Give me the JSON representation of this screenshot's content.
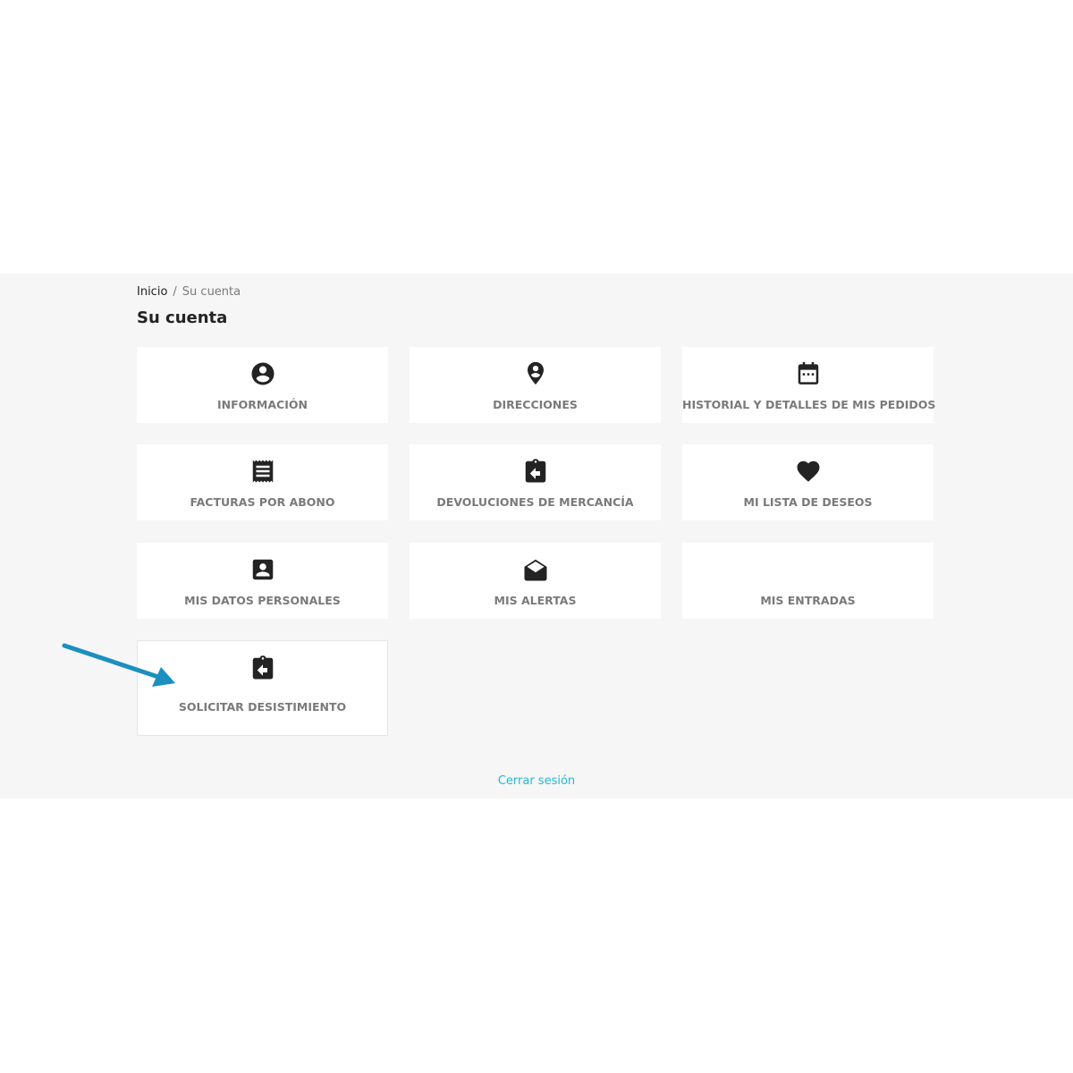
{
  "breadcrumb": {
    "home": "Inicio",
    "separator": "/",
    "current": "Su cuenta"
  },
  "page_title": "Su cuenta",
  "tiles": [
    {
      "label": "INFORMACIÓN",
      "icon": "account-circle-icon"
    },
    {
      "label": "DIRECCIONES",
      "icon": "location-pin-icon"
    },
    {
      "label": "HISTORIAL Y DETALLES DE MIS PEDIDOS",
      "icon": "calendar-icon"
    },
    {
      "label": "FACTURAS POR ABONO",
      "icon": "receipt-icon"
    },
    {
      "label": "DEVOLUCIONES DE MERCANCÍA",
      "icon": "clipboard-return-icon"
    },
    {
      "label": "MI LISTA DE DESEOS",
      "icon": "heart-icon"
    },
    {
      "label": "MIS DATOS PERSONALES",
      "icon": "contact-card-icon"
    },
    {
      "label": "MIS ALERTAS",
      "icon": "envelope-open-icon"
    },
    {
      "label": "MIS ENTRADAS",
      "icon": ""
    },
    {
      "label": "SOLICITAR DESISTIMIENTO",
      "icon": "clipboard-return-icon"
    }
  ],
  "logout_label": "Cerrar sesión",
  "colors": {
    "background_band": "#f6f6f6",
    "tile": "#ffffff",
    "label": "#7a7a7a",
    "link": "#24b9d7",
    "annotation_arrow": "#1a8fc0"
  }
}
